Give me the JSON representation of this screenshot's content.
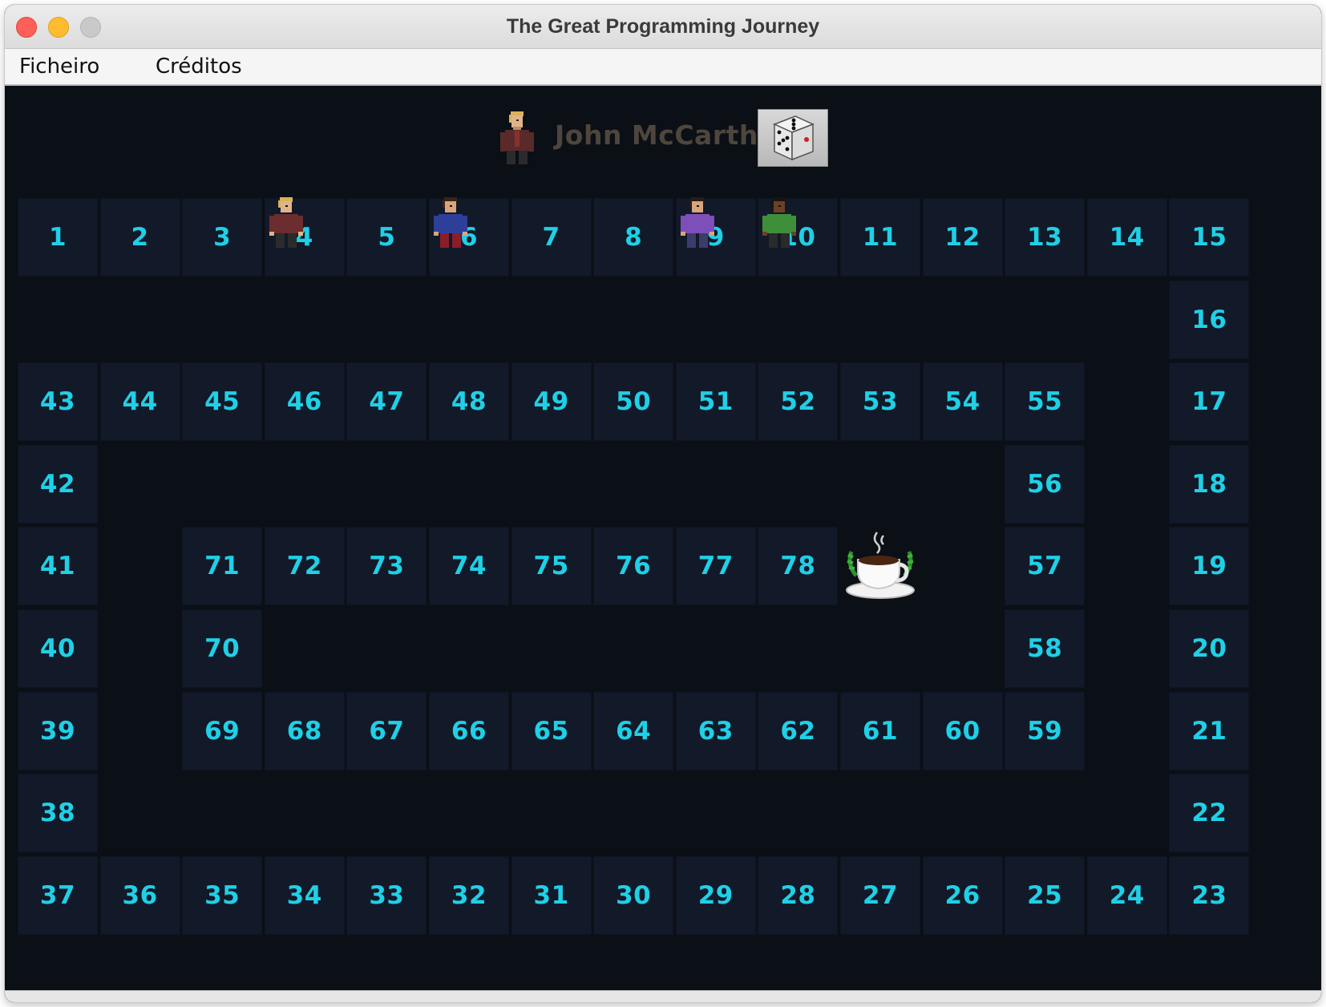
{
  "window": {
    "title": "The Great Programming Journey"
  },
  "menu": {
    "file": "Ficheiro",
    "credits": "Créditos"
  },
  "current_player": {
    "name": "John McCarthy",
    "avatar": "blond-man-avatar"
  },
  "dice": {
    "icon": "dice-icon",
    "face_value": 5
  },
  "board": {
    "cells": [
      {
        "n": "1",
        "row": 0,
        "col": 0
      },
      {
        "n": "2",
        "row": 0,
        "col": 1
      },
      {
        "n": "3",
        "row": 0,
        "col": 2
      },
      {
        "n": "4",
        "row": 0,
        "col": 3
      },
      {
        "n": "5",
        "row": 0,
        "col": 4
      },
      {
        "n": "6",
        "row": 0,
        "col": 5
      },
      {
        "n": "7",
        "row": 0,
        "col": 6
      },
      {
        "n": "8",
        "row": 0,
        "col": 7
      },
      {
        "n": "9",
        "row": 0,
        "col": 8
      },
      {
        "n": "10",
        "row": 0,
        "col": 9
      },
      {
        "n": "11",
        "row": 0,
        "col": 10
      },
      {
        "n": "12",
        "row": 0,
        "col": 11
      },
      {
        "n": "13",
        "row": 0,
        "col": 12
      },
      {
        "n": "14",
        "row": 0,
        "col": 13
      },
      {
        "n": "15",
        "row": 0,
        "col": 14
      },
      {
        "n": "16",
        "row": 1,
        "col": 14
      },
      {
        "n": "43",
        "row": 2,
        "col": 0
      },
      {
        "n": "44",
        "row": 2,
        "col": 1
      },
      {
        "n": "45",
        "row": 2,
        "col": 2
      },
      {
        "n": "46",
        "row": 2,
        "col": 3
      },
      {
        "n": "47",
        "row": 2,
        "col": 4
      },
      {
        "n": "48",
        "row": 2,
        "col": 5
      },
      {
        "n": "49",
        "row": 2,
        "col": 6
      },
      {
        "n": "50",
        "row": 2,
        "col": 7
      },
      {
        "n": "51",
        "row": 2,
        "col": 8
      },
      {
        "n": "52",
        "row": 2,
        "col": 9
      },
      {
        "n": "53",
        "row": 2,
        "col": 10
      },
      {
        "n": "54",
        "row": 2,
        "col": 11
      },
      {
        "n": "55",
        "row": 2,
        "col": 12
      },
      {
        "n": "17",
        "row": 2,
        "col": 14
      },
      {
        "n": "42",
        "row": 3,
        "col": 0
      },
      {
        "n": "56",
        "row": 3,
        "col": 12
      },
      {
        "n": "18",
        "row": 3,
        "col": 14
      },
      {
        "n": "41",
        "row": 4,
        "col": 0
      },
      {
        "n": "71",
        "row": 4,
        "col": 2
      },
      {
        "n": "72",
        "row": 4,
        "col": 3
      },
      {
        "n": "73",
        "row": 4,
        "col": 4
      },
      {
        "n": "74",
        "row": 4,
        "col": 5
      },
      {
        "n": "75",
        "row": 4,
        "col": 6
      },
      {
        "n": "76",
        "row": 4,
        "col": 7
      },
      {
        "n": "77",
        "row": 4,
        "col": 8
      },
      {
        "n": "78",
        "row": 4,
        "col": 9
      },
      {
        "n": "57",
        "row": 4,
        "col": 12
      },
      {
        "n": "19",
        "row": 4,
        "col": 14
      },
      {
        "n": "40",
        "row": 5,
        "col": 0
      },
      {
        "n": "70",
        "row": 5,
        "col": 2
      },
      {
        "n": "58",
        "row": 5,
        "col": 12
      },
      {
        "n": "20",
        "row": 5,
        "col": 14
      },
      {
        "n": "39",
        "row": 6,
        "col": 0
      },
      {
        "n": "69",
        "row": 6,
        "col": 2
      },
      {
        "n": "68",
        "row": 6,
        "col": 3
      },
      {
        "n": "67",
        "row": 6,
        "col": 4
      },
      {
        "n": "66",
        "row": 6,
        "col": 5
      },
      {
        "n": "65",
        "row": 6,
        "col": 6
      },
      {
        "n": "64",
        "row": 6,
        "col": 7
      },
      {
        "n": "63",
        "row": 6,
        "col": 8
      },
      {
        "n": "62",
        "row": 6,
        "col": 9
      },
      {
        "n": "61",
        "row": 6,
        "col": 10
      },
      {
        "n": "60",
        "row": 6,
        "col": 11
      },
      {
        "n": "59",
        "row": 6,
        "col": 12
      },
      {
        "n": "21",
        "row": 6,
        "col": 14
      },
      {
        "n": "38",
        "row": 7,
        "col": 0
      },
      {
        "n": "22",
        "row": 7,
        "col": 14
      },
      {
        "n": "37",
        "row": 8,
        "col": 0
      },
      {
        "n": "36",
        "row": 8,
        "col": 1
      },
      {
        "n": "35",
        "row": 8,
        "col": 2
      },
      {
        "n": "34",
        "row": 8,
        "col": 3
      },
      {
        "n": "33",
        "row": 8,
        "col": 4
      },
      {
        "n": "32",
        "row": 8,
        "col": 5
      },
      {
        "n": "31",
        "row": 8,
        "col": 6
      },
      {
        "n": "30",
        "row": 8,
        "col": 7
      },
      {
        "n": "29",
        "row": 8,
        "col": 8
      },
      {
        "n": "28",
        "row": 8,
        "col": 9
      },
      {
        "n": "27",
        "row": 8,
        "col": 10
      },
      {
        "n": "26",
        "row": 8,
        "col": 11
      },
      {
        "n": "25",
        "row": 8,
        "col": 12
      },
      {
        "n": "24",
        "row": 8,
        "col": 13
      },
      {
        "n": "23",
        "row": 8,
        "col": 14
      }
    ],
    "goal": {
      "row": 4,
      "col": 10,
      "icon": "java-coffee-cup-icon"
    },
    "players": [
      {
        "token": "player-token-blond",
        "square": 4,
        "shirt": "#6b2d2d",
        "hair": "#d8b25a",
        "skin": "#e0b48a",
        "pants": "#2b2b2b"
      },
      {
        "token": "player-token-blue",
        "square": 6,
        "shirt": "#2e3f9a",
        "hair": "#3a2414",
        "skin": "#d9a57c",
        "pants": "#8b1d2a"
      },
      {
        "token": "player-token-purple",
        "square": 9,
        "shirt": "#7e4fb8",
        "hair": "#2a1c14",
        "skin": "#d9a57c",
        "pants": "#3c3c6a"
      },
      {
        "token": "player-token-green",
        "square": 10,
        "shirt": "#3f8f3a",
        "hair": "#1a1410",
        "skin": "#6b4226",
        "pants": "#2a2a2a"
      }
    ]
  },
  "colors": {
    "cell_bg": "#121929",
    "cell_text": "#1fd0e6",
    "board_bg": "#0b0f16",
    "player_name": "#4e463c"
  }
}
